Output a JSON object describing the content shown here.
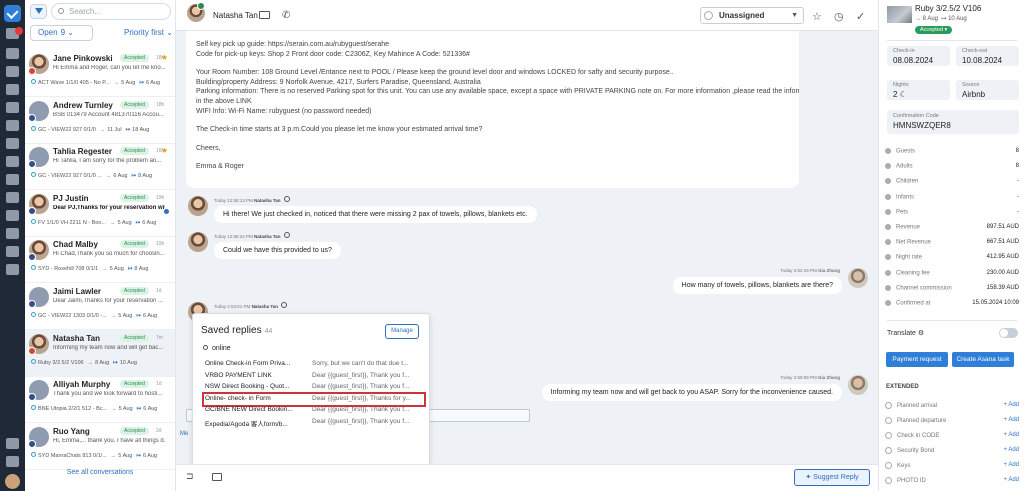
{
  "nav": {
    "badge": "8"
  },
  "sidebar": {
    "search_placeholder": "Search...",
    "open_label": "Open",
    "open_count": "9",
    "sort_label": "Priority first",
    "see_all": "See all conversations",
    "conversations": [
      {
        "name": "Jane Pinkowski",
        "status": "Accepted",
        "time": "18h",
        "preview": "Hi Emma and Roger, can you let me kno...",
        "listing": "ACT Wave 1/1/0 405 - No P...",
        "checkin": "5 Aug",
        "checkout": "6 Aug",
        "starred": true,
        "bold": false
      },
      {
        "name": "Andrew Turnley",
        "status": "Accepted",
        "time": "18h",
        "preview": "BSB 013479 Account 481370116 Accou...",
        "listing": "GC - VIEW22 927 0/1/0",
        "checkin": "11 Jul",
        "checkout": "18 Aug",
        "starred": false,
        "bold": false
      },
      {
        "name": "Tahlia Regester",
        "status": "Accepted",
        "time": "16h",
        "preview": "Hi Tahlia, I am sorry for the problem an...",
        "listing": "GC - VIEW22 927 0/1/0 ...",
        "checkin": "6 Aug",
        "checkout": "8 Aug",
        "starred": true,
        "bold": false
      },
      {
        "name": "PJ Justin",
        "status": "Accepted",
        "time": "19h",
        "preview": "Dear PJ,Thanks for your reservation wit",
        "listing": "FV 1/1/0 VH 2211 N - Boo...",
        "checkin": "5 Aug",
        "checkout": "6 Aug",
        "starred": false,
        "bold": true
      },
      {
        "name": "Chad Malby",
        "status": "Accepted",
        "time": "19h",
        "preview": "Hi Chad,Thank you so much for choosin...",
        "listing": "SYD - Rosehill 708 0/1/1",
        "checkin": "5 Aug",
        "checkout": "8 Aug",
        "starred": false,
        "bold": false
      },
      {
        "name": "Jaimi Lawler",
        "status": "Accepted",
        "time": "1d",
        "preview": "Dear Jaimi,Thanks for your reservation ...",
        "listing": "GC - VIEW22 1303 0/1/0 -...",
        "checkin": "5 Aug",
        "checkout": "6 Aug",
        "starred": false,
        "bold": false
      },
      {
        "name": "Natasha Tan",
        "status": "Accepted",
        "time": "7m",
        "preview": "Informing my team now and will get bac...",
        "listing": "Ruby 3/2.5/2 V106",
        "checkin": "8 Aug",
        "checkout": "10 Aug",
        "starred": false,
        "bold": false
      },
      {
        "name": "Alliyah Murphy",
        "status": "Accepted",
        "time": "1d",
        "preview": "Thank you and we look forward to hosti...",
        "listing": "BNE Utopia 2/2/1 512 - Bc...",
        "checkin": "5 Aug",
        "checkout": "6 Aug",
        "starred": false,
        "bold": false
      },
      {
        "name": "Ruo Yang",
        "status": "Accepted",
        "time": "2d",
        "preview": "Hi, Emma,... thank you. I have all things d...",
        "listing": "SYD ManraChats 813 0/1/...",
        "checkin": "5 Aug",
        "checkout": "6 Aug",
        "starred": false,
        "bold": false
      }
    ]
  },
  "chat": {
    "contact_name": "Natasha Tan",
    "assignee": "Unassigned",
    "host_message": [
      "Self key pick up guide: https://serain.com.au/rubyguest/serahe",
      "Code for pick-up keys: Shop 2 Front door code: C2306Z, Key Mahince A Code: 521336#",
      "",
      "Your Room Number: 108 Ground Level /Entance next to POOL / Please keep the ground level door and windows LOCKED for safty and security purpose..",
      "Building/property Address: 9 Norfolk Avenue, 4217, Surfers Paradise, Queensland, Australia",
      "Parking information: There is no reserved Parking spot for this unit. You can use any available space, except a space with PRIVATE PARKING note on. For more information ,please read the information",
      "in the above LINK",
      "WIFI Info: Wi-Fi Name: rubyguest (no password needed)",
      "",
      "The Check-in time starts at 3 p.m.Could you please let me know your estimated arrival time?",
      "",
      "Cheers,",
      "",
      "Emma & Roger"
    ],
    "messages": [
      {
        "dir": "in",
        "day": "Today",
        "time": "12:58:13 PM",
        "author": "Natasha Tan",
        "text": "Hi there! We just checked in, noticed that there were missing 2 pax of towels, pillows, blankets etc."
      },
      {
        "dir": "in",
        "day": "Today",
        "time": "12:58:24 PM",
        "author": "Natasha Tan",
        "text": "Could we have this provided to us?"
      },
      {
        "dir": "out",
        "day": "Today",
        "time": "2:52:16 PM",
        "author": "Gia Zhang",
        "text": "How many of towels, pillows, blankets are there?"
      },
      {
        "dir": "in",
        "day": "Today",
        "time": "2:53:01 PM",
        "author": "Natasha Tan",
        "text": ""
      },
      {
        "dir": "out",
        "day": "Today",
        "time": "2:59:08 PM",
        "author": "Gia Zhang",
        "text": "Informing my team now and will get back to you ASAP. Sorry for the inconvenience caused."
      }
    ],
    "saved_replies": {
      "title": "Saved replies",
      "count": "44",
      "manage": "Manage",
      "query": "online",
      "items": [
        {
          "title": "Online Check-in Form Priva...",
          "preview": "Sorry, but we can't do that due t..."
        },
        {
          "title": "VRBO PAYMENT LINK",
          "preview": "Dear {{guest_first}}, Thank you f..."
        },
        {
          "title": "NSW Direct Booking - Quot...",
          "preview": "Dear {{guest_first}}, Thank you f..."
        },
        {
          "title": "Online- check- in Form",
          "preview": "Dear {{guest_first}}, Thanks for y..."
        },
        {
          "title": "GC/BNE NEW Direct Bookin...",
          "preview": "Dear {{guest_first}}, Thank you f..."
        },
        {
          "title": "Expedia/Agoda 客人form/b...",
          "preview": "Dear {{guest_first}}, Thank you f..."
        }
      ],
      "highlighted_index": 3
    },
    "composer_tab": "Me",
    "suggest_reply": "Suggest Reply"
  },
  "booking": {
    "listing": "Ruby 3/2.5/2 V106",
    "checkin_short": "8 Aug",
    "checkout_short": "10 Aug",
    "status": "Accepted",
    "checkin_label": "Check-in",
    "checkin": "08.08.2024",
    "checkout_label": "Check-out",
    "checkout": "10.08.2024",
    "nights_label": "Nights",
    "nights": "2",
    "source_label": "Source",
    "source": "Airbnb",
    "confirmation_label": "Confirmation Code",
    "confirmation": "HMNSWZQER8",
    "details": [
      {
        "label": "Guests",
        "value": "8"
      },
      {
        "label": "Adults",
        "value": "8"
      },
      {
        "label": "Children",
        "value": "-"
      },
      {
        "label": "Infants",
        "value": "-"
      },
      {
        "label": "Pets",
        "value": "-"
      },
      {
        "label": "Revenue",
        "value": "897.51 AUD"
      },
      {
        "label": "Net Revenue",
        "value": "667.51 AUD"
      },
      {
        "label": "Night rate",
        "value": "412.95 AUD"
      },
      {
        "label": "Cleaning fee",
        "value": "230.00 AUD"
      },
      {
        "label": "Channel commission",
        "value": "158.39 AUD"
      },
      {
        "label": "Confirmed at",
        "value": "15.05.2024 10:09"
      }
    ],
    "translate_label": "Translate",
    "payment_request": "Payment request",
    "create_task": "Create Asana task",
    "extended_label": "EXTENDED",
    "extended": [
      {
        "label": "Planned arrival",
        "action": "+ Add"
      },
      {
        "label": "Planned departure",
        "action": "+ Add"
      },
      {
        "label": "Check in CODE",
        "action": "+ Add"
      },
      {
        "label": "Security Bond",
        "action": "+ Add"
      },
      {
        "label": "Keys",
        "action": "+ Add"
      },
      {
        "label": "PHOTO ID",
        "action": "+ Add"
      }
    ]
  }
}
